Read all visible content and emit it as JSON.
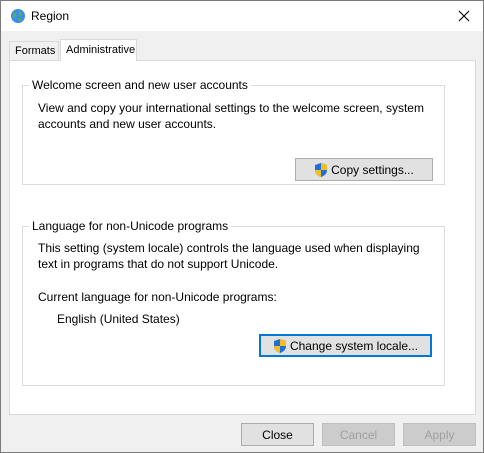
{
  "window": {
    "title": "Region",
    "close_icon": "close-icon",
    "app_icon": "globe-icon"
  },
  "tabs": [
    {
      "label": "Formats",
      "active": false
    },
    {
      "label": "Administrative",
      "active": true
    }
  ],
  "welcome_group": {
    "legend": "Welcome screen and new user accounts",
    "description_line1": "View and copy your international settings to the welcome screen, system",
    "description_line2": "accounts and new user accounts.",
    "button_label": "Copy settings...",
    "button_icon": "uac-shield-icon"
  },
  "unicode_group": {
    "legend": "Language for non-Unicode programs",
    "description_line1": "This setting (system locale) controls the language used when displaying",
    "description_line2": "text in programs that do not support Unicode.",
    "current_label": "Current language for non-Unicode programs:",
    "current_value": "English (United States)",
    "button_label": "Change system locale...",
    "button_icon": "uac-shield-icon"
  },
  "footer": {
    "close_label": "Close",
    "cancel_label": "Cancel",
    "apply_label": "Apply"
  },
  "colors": {
    "focus_border": "#0078d7",
    "panel_bg": "#ffffff",
    "window_bg": "#f0f0f0"
  }
}
